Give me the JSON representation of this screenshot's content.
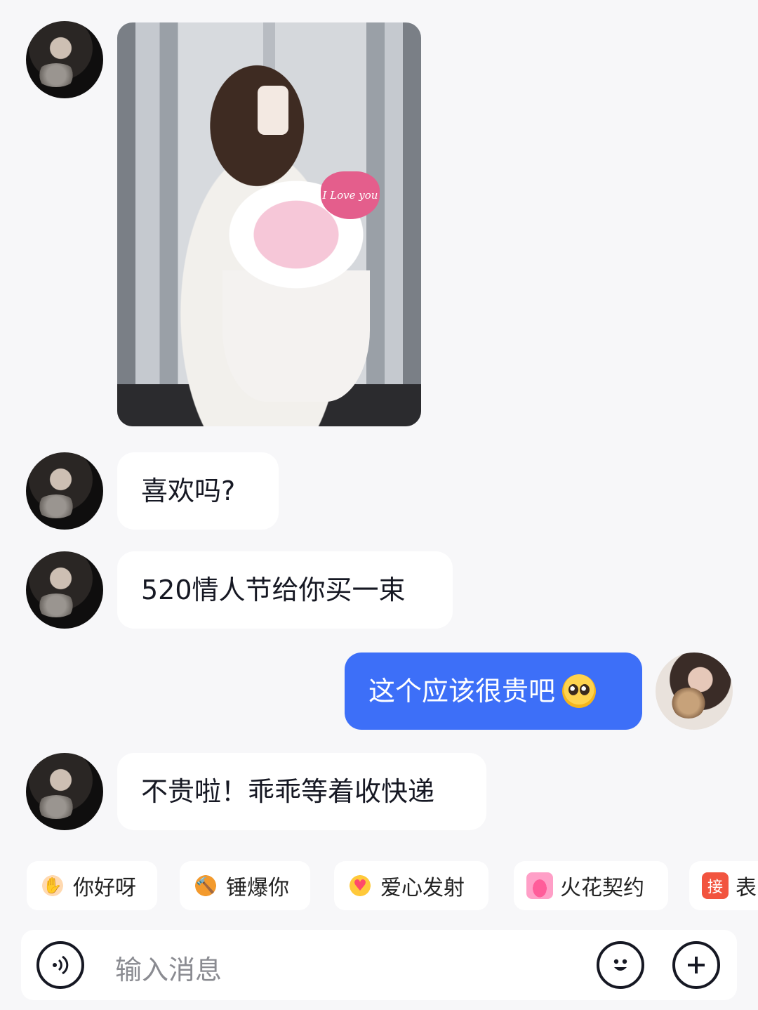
{
  "messages": [
    {
      "from": "other",
      "type": "image",
      "image_caption": "I Love you"
    },
    {
      "from": "other",
      "type": "text",
      "text": "喜欢吗?"
    },
    {
      "from": "other",
      "type": "text",
      "text": "520情人节给你买一束"
    },
    {
      "from": "me",
      "type": "text",
      "text": "这个应该很贵吧",
      "emoji": "pleading-face-icon"
    },
    {
      "from": "other",
      "type": "text",
      "text": "不贵啦！乖乖等着收快递"
    }
  ],
  "quick_replies": [
    {
      "label": "你好呀",
      "icon": "wave-hand-icon"
    },
    {
      "label": "锤爆你",
      "icon": "hammer-icon"
    },
    {
      "label": "爱心发射",
      "icon": "love-shoot-icon"
    },
    {
      "label": "火花契约",
      "icon": "spark-fire-icon"
    },
    {
      "label": "表",
      "icon": "jie-badge-icon",
      "icon_text": "接"
    }
  ],
  "input": {
    "placeholder": "输入消息",
    "voice_icon": "voice-icon",
    "emoji_icon": "emoji-icon",
    "plus_icon": "plus-icon"
  },
  "colors": {
    "background": "#f7f7f9",
    "my_bubble": "#3d6ff8",
    "other_bubble": "#ffffff"
  }
}
